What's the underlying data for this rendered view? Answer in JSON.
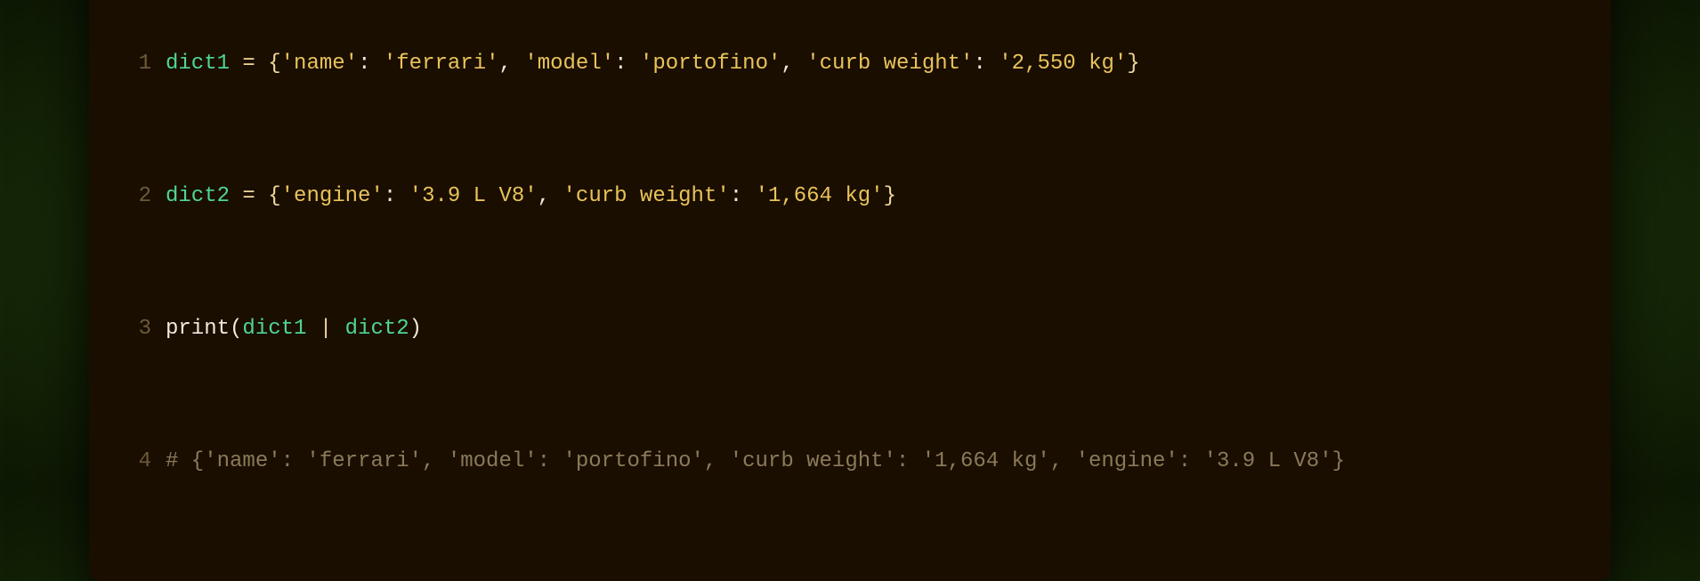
{
  "traffic_lights": {
    "red": "close",
    "yellow": "minimize",
    "green": "maximize"
  },
  "code": {
    "line_numbers": [
      "1",
      "2",
      "3",
      "4"
    ],
    "line1": {
      "var": "dict1",
      "sp1": " ",
      "eq": "=",
      "sp2": " ",
      "lb": "{",
      "k1": "'name'",
      "c1": ": ",
      "v1": "'ferrari'",
      "cm1": ", ",
      "k2": "'model'",
      "c2": ": ",
      "v2": "'portofino'",
      "cm2": ", ",
      "k3": "'curb weight'",
      "c3": ": ",
      "v3": "'2,550 kg'",
      "rb": "}"
    },
    "line2": {
      "var": "dict2",
      "sp1": " ",
      "eq": "=",
      "sp2": " ",
      "lb": "{",
      "k1": "'engine'",
      "c1": ": ",
      "v1": "'3.9 L V8'",
      "cm1": ", ",
      "k2": "'curb weight'",
      "c2": ": ",
      "v2": "'1,664 kg'",
      "rb": "}"
    },
    "line3": {
      "fn": "print",
      "lp": "(",
      "a1": "dict1",
      "sp1": " ",
      "pipe": "|",
      "sp2": " ",
      "a2": "dict2",
      "rp": ")"
    },
    "line4": {
      "comment": "# {'name': 'ferrari', 'model': 'portofino', 'curb weight': '1,664 kg', 'engine': '3.9 L V8'}"
    }
  }
}
